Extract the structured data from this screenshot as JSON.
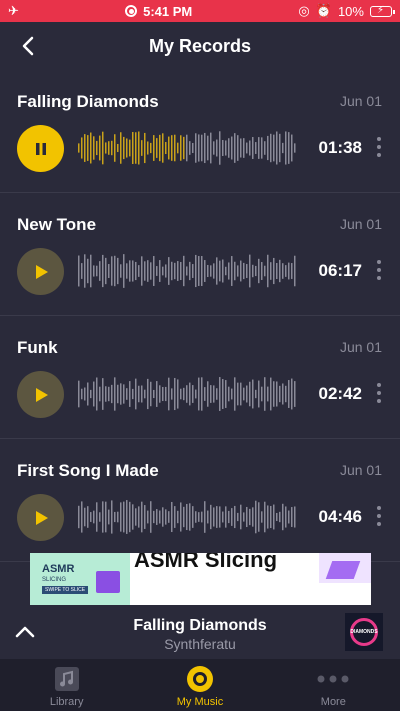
{
  "status_bar": {
    "time": "5:41 PM",
    "battery": "10%"
  },
  "header": {
    "title": "My Records"
  },
  "records": [
    {
      "title": "Falling Diamonds",
      "date": "Jun 01",
      "duration": "01:38",
      "playing": true
    },
    {
      "title": "New Tone",
      "date": "Jun 01",
      "duration": "06:17",
      "playing": false
    },
    {
      "title": "Funk",
      "date": "Jun 01",
      "duration": "02:42",
      "playing": false
    },
    {
      "title": "First Song I Made",
      "date": "Jun 01",
      "duration": "04:46",
      "playing": false
    }
  ],
  "ad": {
    "thumb_title": "ASMR",
    "thumb_subtitle": "SLICING",
    "thumb_cta": "SWIPE TO SLICE",
    "headline": "ASMR Slicing"
  },
  "now_playing": {
    "title": "Falling Diamonds",
    "artist": "Synthferatu",
    "album_art_text": "DIAMONDS"
  },
  "tabs": [
    {
      "label": "Library",
      "active": false
    },
    {
      "label": "My Music",
      "active": true
    },
    {
      "label": "More",
      "active": false
    }
  ],
  "colors": {
    "accent": "#f2c300",
    "background": "#2a2a3a",
    "status_bar": "#e8334a",
    "tab_bar": "#1f1f2c"
  }
}
